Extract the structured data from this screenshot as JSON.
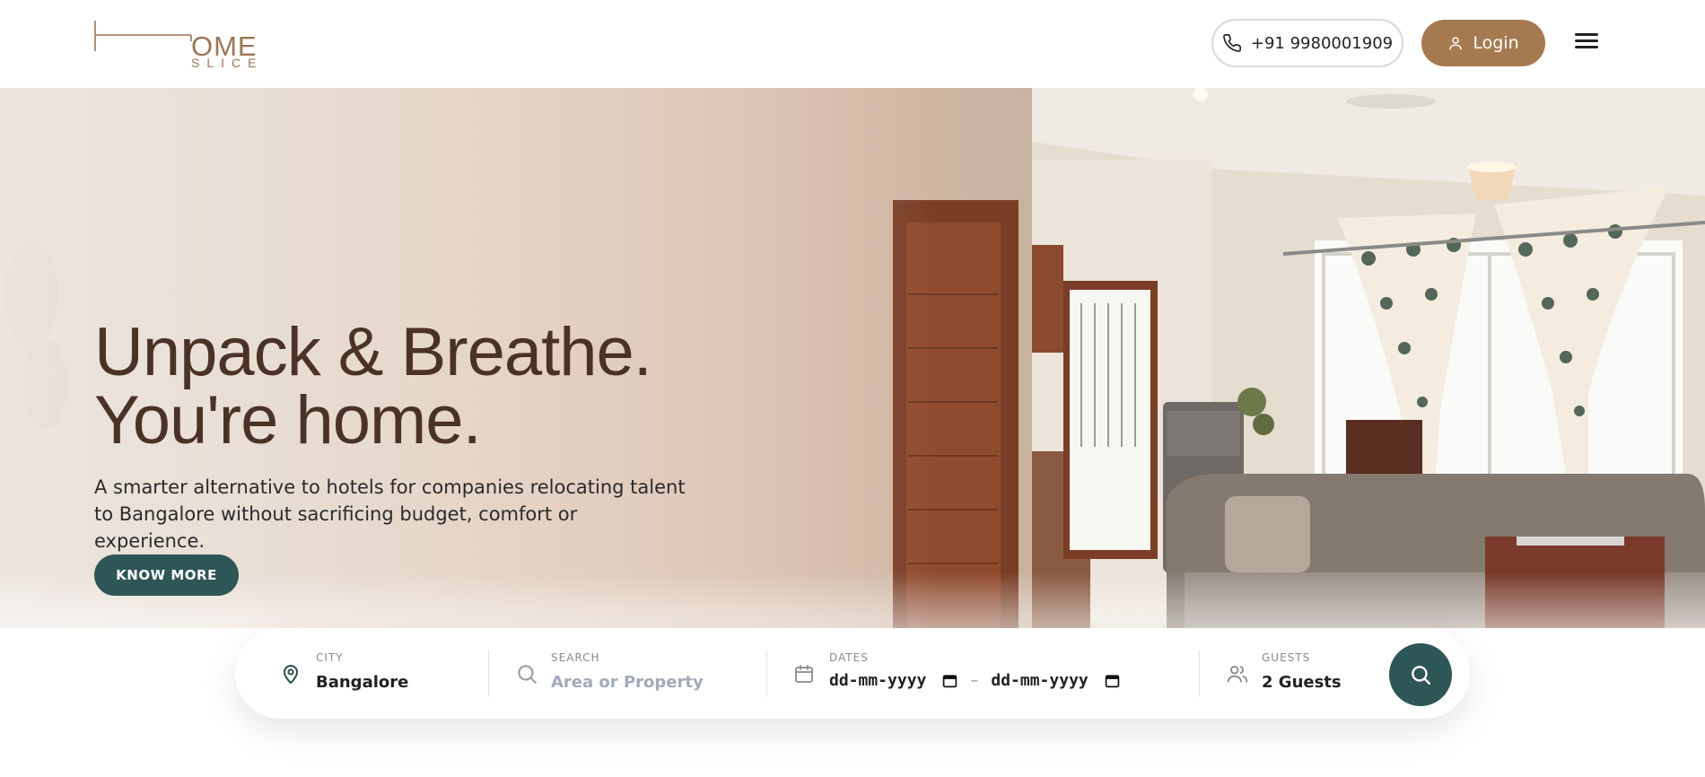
{
  "brand": {
    "logo_text_main": "OME",
    "logo_text_sub": "SLICE",
    "logo_name": "homeslice-logo"
  },
  "header": {
    "phone": "+91 9980001909",
    "login_label": "Login",
    "menu_icon": "hamburger-icon"
  },
  "hero": {
    "headline_line1": "Unpack & Breathe.",
    "headline_line2": "You're home.",
    "subcopy": "A smarter alternative to hotels for companies relocating talent to Bangalore without sacrificing budget, comfort or experience.",
    "cta_label": "KNOW MORE"
  },
  "search": {
    "city_label": "CITY",
    "city_value": "Bangalore",
    "query_label": "SEARCH",
    "query_placeholder": "Area or Property",
    "dates_label": "DATES",
    "date_from": "dd-mm-yyyy",
    "date_to": "dd-mm-yyyy",
    "date_separator": "–",
    "guests_label": "GUESTS",
    "guests_value": "2 Guests"
  },
  "colors": {
    "brand_brown": "#a67a50",
    "accent_teal": "#2f5656",
    "headline_brown": "#4a3326"
  }
}
